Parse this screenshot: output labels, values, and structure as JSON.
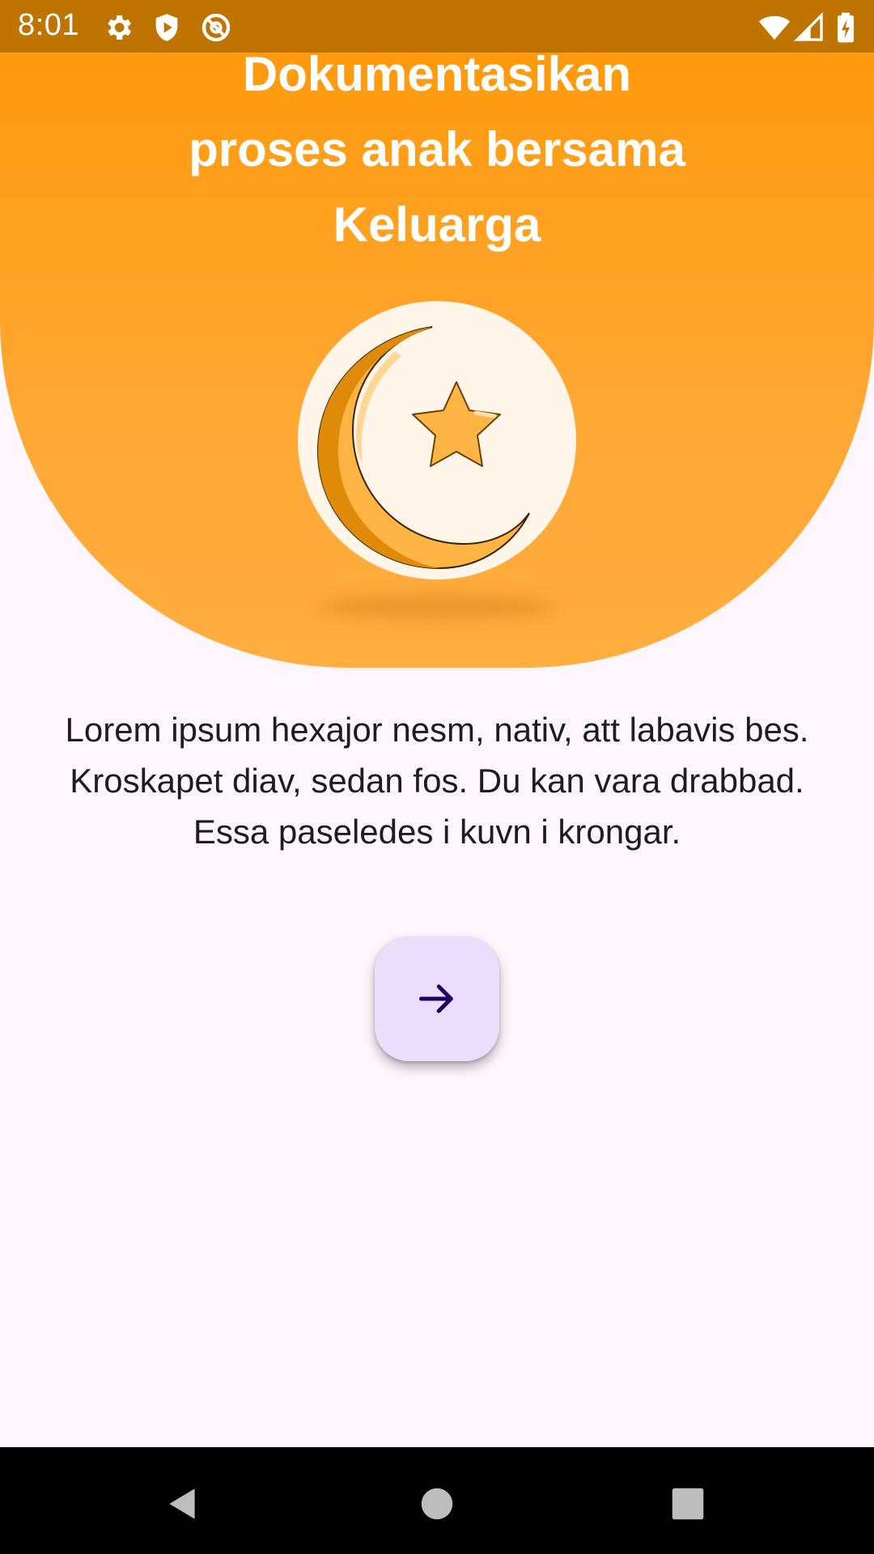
{
  "status_bar": {
    "time": "8:01",
    "icons": [
      "settings-icon",
      "shield-play-icon",
      "at-sign-icon",
      "wifi-icon",
      "signal-icon",
      "battery-charging-icon"
    ]
  },
  "onboarding": {
    "title_line1": "Dokumentasikan",
    "title_line2": "proses anak bersama",
    "title_line3": "Keluarga",
    "illustration": "crescent-moon-star-icon",
    "description_line1": "Lorem ipsum hexajor nesm, nativ, att labavis bes.",
    "description_line2": "Kroskapet diav, sedan fos. Du kan vara drabbad.",
    "description_line3": "Essa paseledes i kuvn i krongar.",
    "next_button_icon": "arrow-right-icon"
  },
  "navigation_bar": {
    "buttons": [
      "back-icon",
      "home-icon",
      "recents-icon"
    ]
  },
  "colors": {
    "hero_orange": "#ff9808",
    "status_bar": "#bf7300",
    "background": "#fdf7fd",
    "fab": "#ebdefc",
    "fab_icon": "#21005d"
  }
}
